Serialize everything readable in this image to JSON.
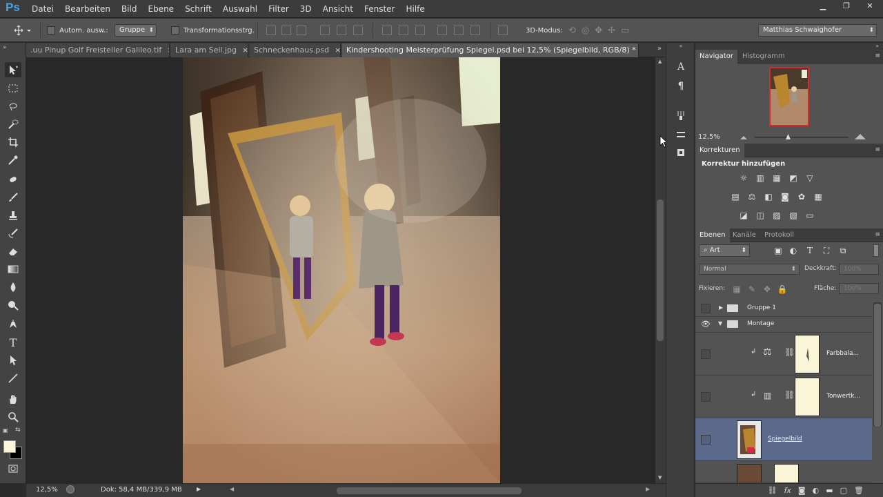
{
  "app": {
    "logo": "Ps"
  },
  "menu": [
    "Datei",
    "Bearbeiten",
    "Bild",
    "Ebene",
    "Schrift",
    "Auswahl",
    "Filter",
    "3D",
    "Ansicht",
    "Fenster",
    "Hilfe"
  ],
  "window_controls": {
    "minimize": "▁",
    "restore": "❐",
    "close": "✕"
  },
  "options": {
    "auto_select_label": "Autom. ausw.:",
    "auto_select_value": "Gruppe",
    "transform_label": "Transformationsstrg.",
    "mode_3d_label": "3D-Modus:",
    "workspace": "Matthias Schwaighofer"
  },
  "tabs": [
    {
      "label": ".uu Pinup Golf Freisteller Galileo.tif",
      "close": "×"
    },
    {
      "label": "Lara am Seil.jpg",
      "close": "×"
    },
    {
      "label": "Schneckenhaus.psd",
      "close": "×"
    },
    {
      "label": "Kindershooting Meisterprüfung Spiegel.psd bei 12,5% (Spiegelbild, RGB/8) *",
      "close": "×"
    }
  ],
  "status": {
    "zoom": "12,5%",
    "doc": "Dok: 58,4 MB/339,9 MB"
  },
  "navigator": {
    "tabs": [
      "Navigator",
      "Histogramm"
    ],
    "zoom": "12,5%"
  },
  "korrekturen": {
    "tab": "Korrekturen",
    "heading": "Korrektur hinzufügen"
  },
  "layers_panel": {
    "tabs": [
      "Ebenen",
      "Kanäle",
      "Protokoll"
    ],
    "filter": "Art",
    "blend_mode": "Normal",
    "opacity_label": "Deckkraft:",
    "opacity_value": "100%",
    "lock_label": "Fixieren:",
    "fill_label": "Fläche:",
    "fill_value": "100%",
    "layers": [
      {
        "name": "Gruppe 1",
        "type": "group",
        "expanded": false,
        "visible": false
      },
      {
        "name": "Montage",
        "type": "group",
        "expanded": true,
        "visible": true
      },
      {
        "name": "Farbbala...",
        "type": "adjustment",
        "visible": false
      },
      {
        "name": "Tonwertk...",
        "type": "adjustment",
        "visible": false
      },
      {
        "name": "Spiegelbild",
        "type": "pixel",
        "visible": false,
        "selected": true
      }
    ]
  }
}
